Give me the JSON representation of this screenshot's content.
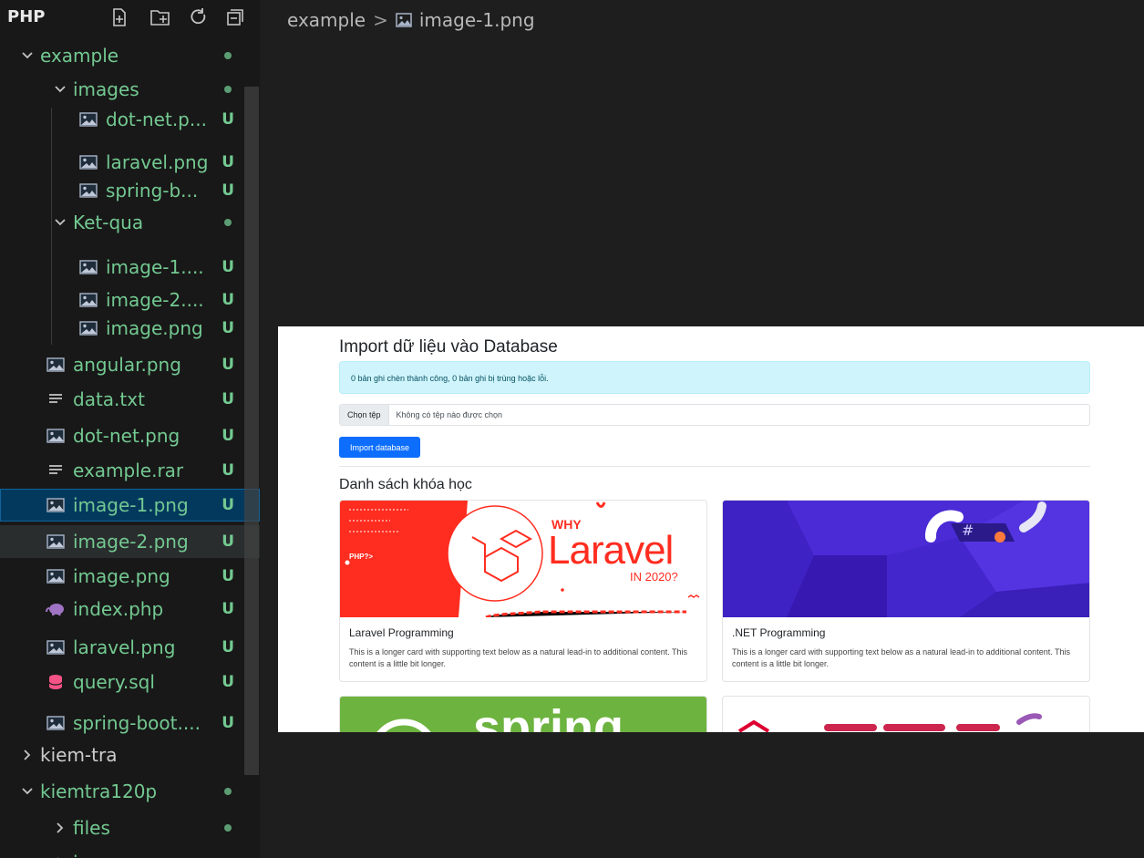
{
  "explorer": {
    "root_label": "PHP",
    "rows": [
      {
        "label": "example",
        "kind": "folder",
        "open": true,
        "status": "dot"
      },
      {
        "label": "images",
        "kind": "folder",
        "open": true,
        "status": "dot"
      },
      {
        "label": "dot-net.p...",
        "kind": "image",
        "status": "U"
      },
      {
        "label": "laravel.png",
        "kind": "image",
        "status": "U"
      },
      {
        "label": "spring-b...",
        "kind": "image",
        "status": "U"
      },
      {
        "label": "Ket-qua",
        "kind": "folder",
        "open": true,
        "status": "dot"
      },
      {
        "label": "image-1....",
        "kind": "image",
        "status": "U"
      },
      {
        "label": "image-2....",
        "kind": "image",
        "status": "U"
      },
      {
        "label": "image.png",
        "kind": "image",
        "status": "U"
      },
      {
        "label": "angular.png",
        "kind": "image",
        "status": "U"
      },
      {
        "label": "data.txt",
        "kind": "text",
        "status": "U"
      },
      {
        "label": "dot-net.png",
        "kind": "image",
        "status": "U"
      },
      {
        "label": "example.rar",
        "kind": "text",
        "status": "U"
      },
      {
        "label": "image-1.png",
        "kind": "image",
        "status": "U",
        "selected": true
      },
      {
        "label": "image-2.png",
        "kind": "image",
        "status": "U",
        "hover": true
      },
      {
        "label": "image.png",
        "kind": "image",
        "status": "U"
      },
      {
        "label": "index.php",
        "kind": "php",
        "status": "U"
      },
      {
        "label": "laravel.png",
        "kind": "image",
        "status": "U"
      },
      {
        "label": "query.sql",
        "kind": "sql",
        "status": "U"
      },
      {
        "label": "spring-boot....",
        "kind": "image",
        "status": "U"
      },
      {
        "label": "kiem-tra",
        "kind": "folder",
        "open": false,
        "status": ""
      },
      {
        "label": "kiemtra120p",
        "kind": "folder",
        "open": true,
        "status": "dot"
      },
      {
        "label": "files",
        "kind": "folder",
        "open": false,
        "status": "dot"
      },
      {
        "label": "images",
        "kind": "folder",
        "open": false,
        "status": "dot"
      }
    ]
  },
  "breadcrumb": {
    "folder": "example",
    "separator": ">",
    "file": "image-1.png"
  },
  "preview": {
    "title": "Import dữ liệu vào Database",
    "alert": "0 bản ghi chèn thành công, 0 bản ghi bị trùng hoặc lỗi.",
    "file_button": "Chọn tệp",
    "file_status": "Không có tệp nào được chọn",
    "import_button": "Import database",
    "section_heading": "Danh sách khóa học",
    "cards": [
      {
        "title": "Laravel Programming",
        "text": "This is a longer card with supporting text below as a natural lead-in to additional content. This content is a little bit longer."
      },
      {
        "title": ".NET Programming",
        "text": "This is a longer card with supporting text below as a natural lead-in to additional content. This content is a little bit longer."
      }
    ],
    "laravel_banner": {
      "why": "WHY",
      "brand": "Laravel",
      "year": "IN 2020?",
      "php": "PHP?>"
    },
    "spring_banner": {
      "brand": "spring"
    }
  },
  "colors": {
    "sidebar_bg": "#181818",
    "editor_bg": "#1e1e1e",
    "git_untracked": "#73c991",
    "selection": "#04395e",
    "bootstrap_primary": "#0d6efd",
    "alert_info": "#cff4fc",
    "laravel_red": "#ff2d20",
    "dotnet_purple": "#512bd4",
    "spring_green": "#6db33f"
  }
}
